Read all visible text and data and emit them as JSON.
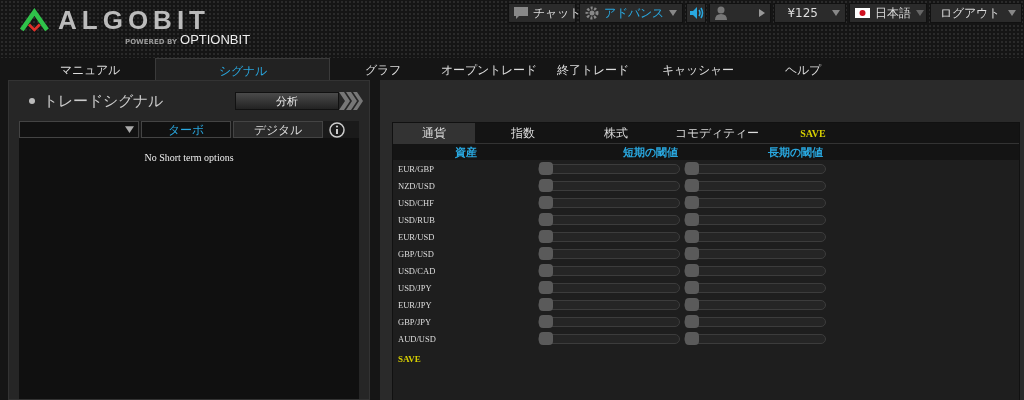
{
  "logo": {
    "name": "ALGOBIT",
    "tagline": "POWERED BY",
    "partner": "OPTIONBIT"
  },
  "topbar": {
    "chat": "チャット",
    "mode": "アドバンス",
    "balance": "¥125",
    "language": "日本語",
    "logout": "ログアウト"
  },
  "nav": [
    {
      "label": "マニュアル",
      "selected": false
    },
    {
      "label": "シグナル",
      "selected": true
    },
    {
      "label": "グラフ",
      "selected": false
    },
    {
      "label": "オープントレード",
      "selected": false
    },
    {
      "label": "終了トレード",
      "selected": false
    },
    {
      "label": "キャッシャー",
      "selected": false
    },
    {
      "label": "ヘルプ",
      "selected": false
    }
  ],
  "signals": {
    "title": "トレードシグナル",
    "analyze_button": "分析",
    "filter_tabs": [
      {
        "label": "ターボ",
        "selected": true
      },
      {
        "label": "デジタル",
        "selected": false
      }
    ],
    "empty_message": "No Short term options"
  },
  "settings": {
    "tabs": [
      {
        "label": "通貨",
        "selected": true
      },
      {
        "label": "指数",
        "selected": false
      },
      {
        "label": "株式",
        "selected": false
      },
      {
        "label": "コモディティー",
        "selected": false
      }
    ],
    "save_tab": "SAVE",
    "columns": [
      "資産",
      "短期の閾値",
      "長期の閾値"
    ],
    "rows": [
      {
        "asset": "EUR/GBP",
        "short": {
          "level": 0
        },
        "long": {
          "level": 0
        }
      },
      {
        "asset": "NZD/USD",
        "short": {
          "level": 0
        },
        "long": {
          "level": 0
        }
      },
      {
        "asset": "USD/CHF",
        "short": {
          "level": 0
        },
        "long": {
          "level": 0
        }
      },
      {
        "asset": "USD/RUB",
        "short": {
          "level": 0
        },
        "long": {
          "level": 0
        }
      },
      {
        "asset": "EUR/USD",
        "short": {
          "level": 0
        },
        "long": {
          "level": 0
        }
      },
      {
        "asset": "GBP/USD",
        "short": {
          "level": 0
        },
        "long": {
          "level": 0
        }
      },
      {
        "asset": "USD/CAD",
        "short": {
          "level": 0
        },
        "long": {
          "level": 0
        }
      },
      {
        "asset": "USD/JPY",
        "short": {
          "level": 0
        },
        "long": {
          "level": 0
        }
      },
      {
        "asset": "EUR/JPY",
        "short": {
          "level": 0
        },
        "long": {
          "level": 0
        }
      },
      {
        "asset": "GBP/JPY",
        "short": {
          "level": 0
        },
        "long": {
          "level": 0
        }
      },
      {
        "asset": "AUD/USD",
        "short": {
          "level": 0
        },
        "long": {
          "level": 0
        }
      }
    ],
    "save_link": "SAVE"
  }
}
